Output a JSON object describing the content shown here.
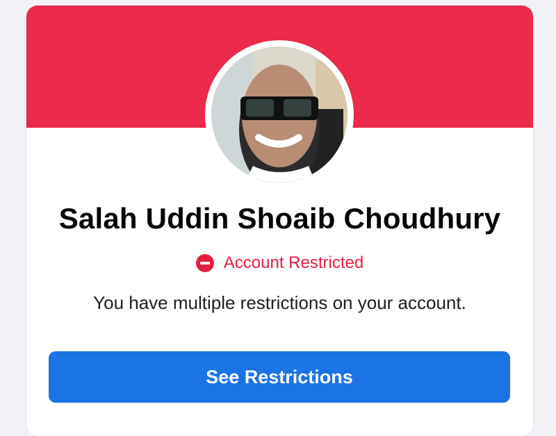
{
  "profile": {
    "name": "Salah Uddin Shoaib Choudhury",
    "avatar_alt": "profile-photo"
  },
  "status": {
    "icon": "restricted-icon",
    "label": "Account Restricted",
    "color": "#e41e3f"
  },
  "description": "You have multiple restrictions on your account.",
  "actions": {
    "see_restrictions_label": "See Restrictions"
  },
  "colors": {
    "banner": "#ea294b",
    "button": "#1b74e4"
  }
}
